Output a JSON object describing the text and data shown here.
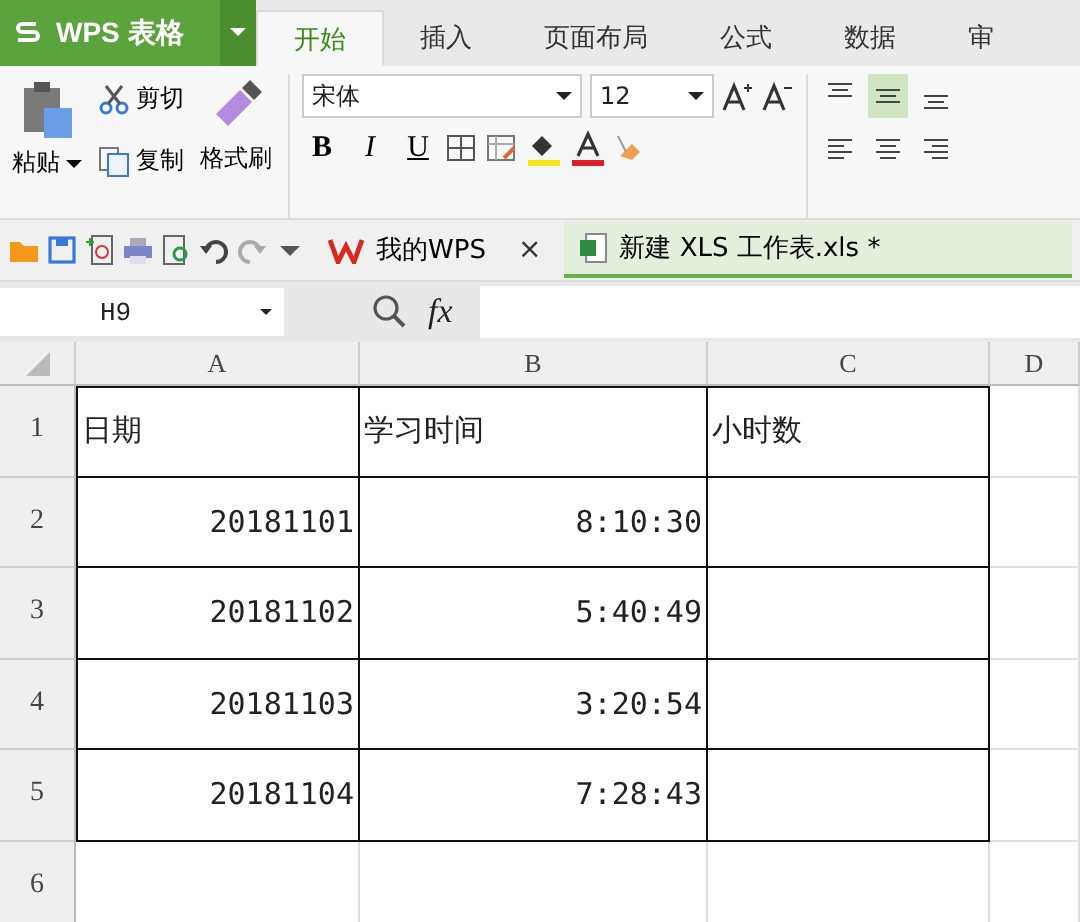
{
  "app_menu": {
    "label": "WPS 表格"
  },
  "tabs": [
    {
      "label": "开始",
      "selected": true
    },
    {
      "label": "插入",
      "selected": false
    },
    {
      "label": "页面布局",
      "selected": false
    },
    {
      "label": "公式",
      "selected": false
    },
    {
      "label": "数据",
      "selected": false
    },
    {
      "label": "审",
      "selected": false
    }
  ],
  "ribbon": {
    "paste": "粘贴",
    "cut": "剪切",
    "copy": "复制",
    "format_painter": "格式刷",
    "font_family": "宋体",
    "font_size": "12",
    "bold": "B",
    "italic": "I",
    "underline": "U",
    "vertical_align": [
      {
        "selected": false
      },
      {
        "selected": true
      },
      {
        "selected": false
      }
    ]
  },
  "doc_tabs": [
    {
      "label": "我的WPS",
      "kind": "home",
      "close": "×",
      "selected": false
    },
    {
      "label": "新建 XLS 工作表.xls *",
      "kind": "sheet",
      "selected": true
    }
  ],
  "formula_bar": {
    "name_box": "H9",
    "fx": "fx"
  },
  "columns": [
    "A",
    "B",
    "C",
    "D"
  ],
  "rows": [
    {
      "number": "1",
      "framed": true,
      "kind": "header",
      "cells": [
        "日期",
        "学习时间",
        "小时数"
      ]
    },
    {
      "number": "2",
      "framed": true,
      "kind": "data",
      "cells": [
        "20181101",
        "8:10:30"
      ]
    },
    {
      "number": "3",
      "framed": true,
      "kind": "data",
      "cells": [
        "20181102",
        "5:40:49"
      ]
    },
    {
      "number": "4",
      "framed": true,
      "kind": "data",
      "cells": [
        "20181103",
        "3:20:54"
      ]
    },
    {
      "number": "5",
      "framed": true,
      "kind": "data",
      "cells": [
        "20181104",
        "7:28:43"
      ]
    },
    {
      "number": "6",
      "framed": false,
      "kind": "data",
      "cells": []
    }
  ]
}
